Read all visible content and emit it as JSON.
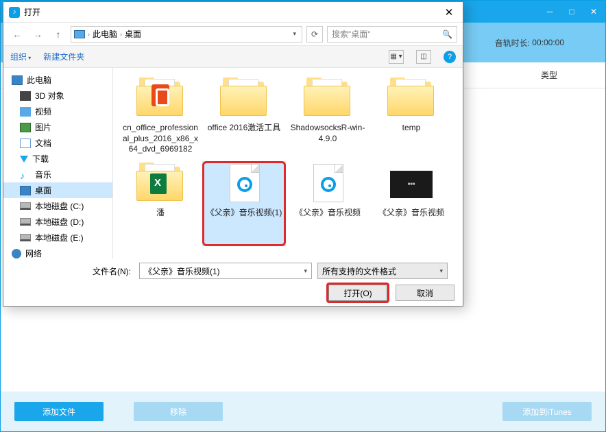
{
  "app": {
    "duration_label": "音轨时长:",
    "duration_value": "00:00:00",
    "column_type": "类型",
    "footer": {
      "add_file": "添加文件",
      "remove": "移除",
      "add_to_itunes": "添加到iTunes"
    }
  },
  "dialog": {
    "title": "打开",
    "breadcrumb": {
      "pc": "此电脑",
      "location": "桌面"
    },
    "search_placeholder": "搜索\"桌面\"",
    "toolbar": {
      "organize": "组织",
      "new_folder": "新建文件夹"
    },
    "tree": [
      {
        "label": "此电脑",
        "icon": "pc",
        "top": true
      },
      {
        "label": "3D 对象",
        "icon": "cube"
      },
      {
        "label": "视频",
        "icon": "vid"
      },
      {
        "label": "图片",
        "icon": "img"
      },
      {
        "label": "文档",
        "icon": "doc"
      },
      {
        "label": "下载",
        "icon": "down"
      },
      {
        "label": "音乐",
        "icon": "music"
      },
      {
        "label": "桌面",
        "icon": "desk",
        "selected": true
      },
      {
        "label": "本地磁盘 (C:)",
        "icon": "disk"
      },
      {
        "label": "本地磁盘 (D:)",
        "icon": "disk"
      },
      {
        "label": "本地磁盘 (E:)",
        "icon": "disk"
      },
      {
        "label": "网络",
        "icon": "net",
        "top": true
      }
    ],
    "files_row1": [
      {
        "label": "cn_office_professional_plus_2016_x86_x64_dvd_6969182",
        "kind": "folder-office"
      },
      {
        "label": "office 2016激活工具",
        "kind": "folder"
      },
      {
        "label": "ShadowsocksR-win-4.9.0",
        "kind": "folder"
      },
      {
        "label": "temp",
        "kind": "folder"
      }
    ],
    "files_row2": [
      {
        "label": "潘",
        "kind": "folder-excel"
      },
      {
        "label": "《父亲》音乐视频(1)",
        "kind": "media-doc",
        "selected": true,
        "highlighted": true
      },
      {
        "label": "《父亲》音乐视频",
        "kind": "media-doc"
      },
      {
        "label": "《父亲》音乐视频",
        "kind": "video-thumb"
      }
    ],
    "filename_label": "文件名(N):",
    "filename_value": "《父亲》音乐视频(1)",
    "filetype_value": "所有支持的文件格式",
    "open_btn": "打开(O)",
    "cancel_btn": "取消"
  }
}
